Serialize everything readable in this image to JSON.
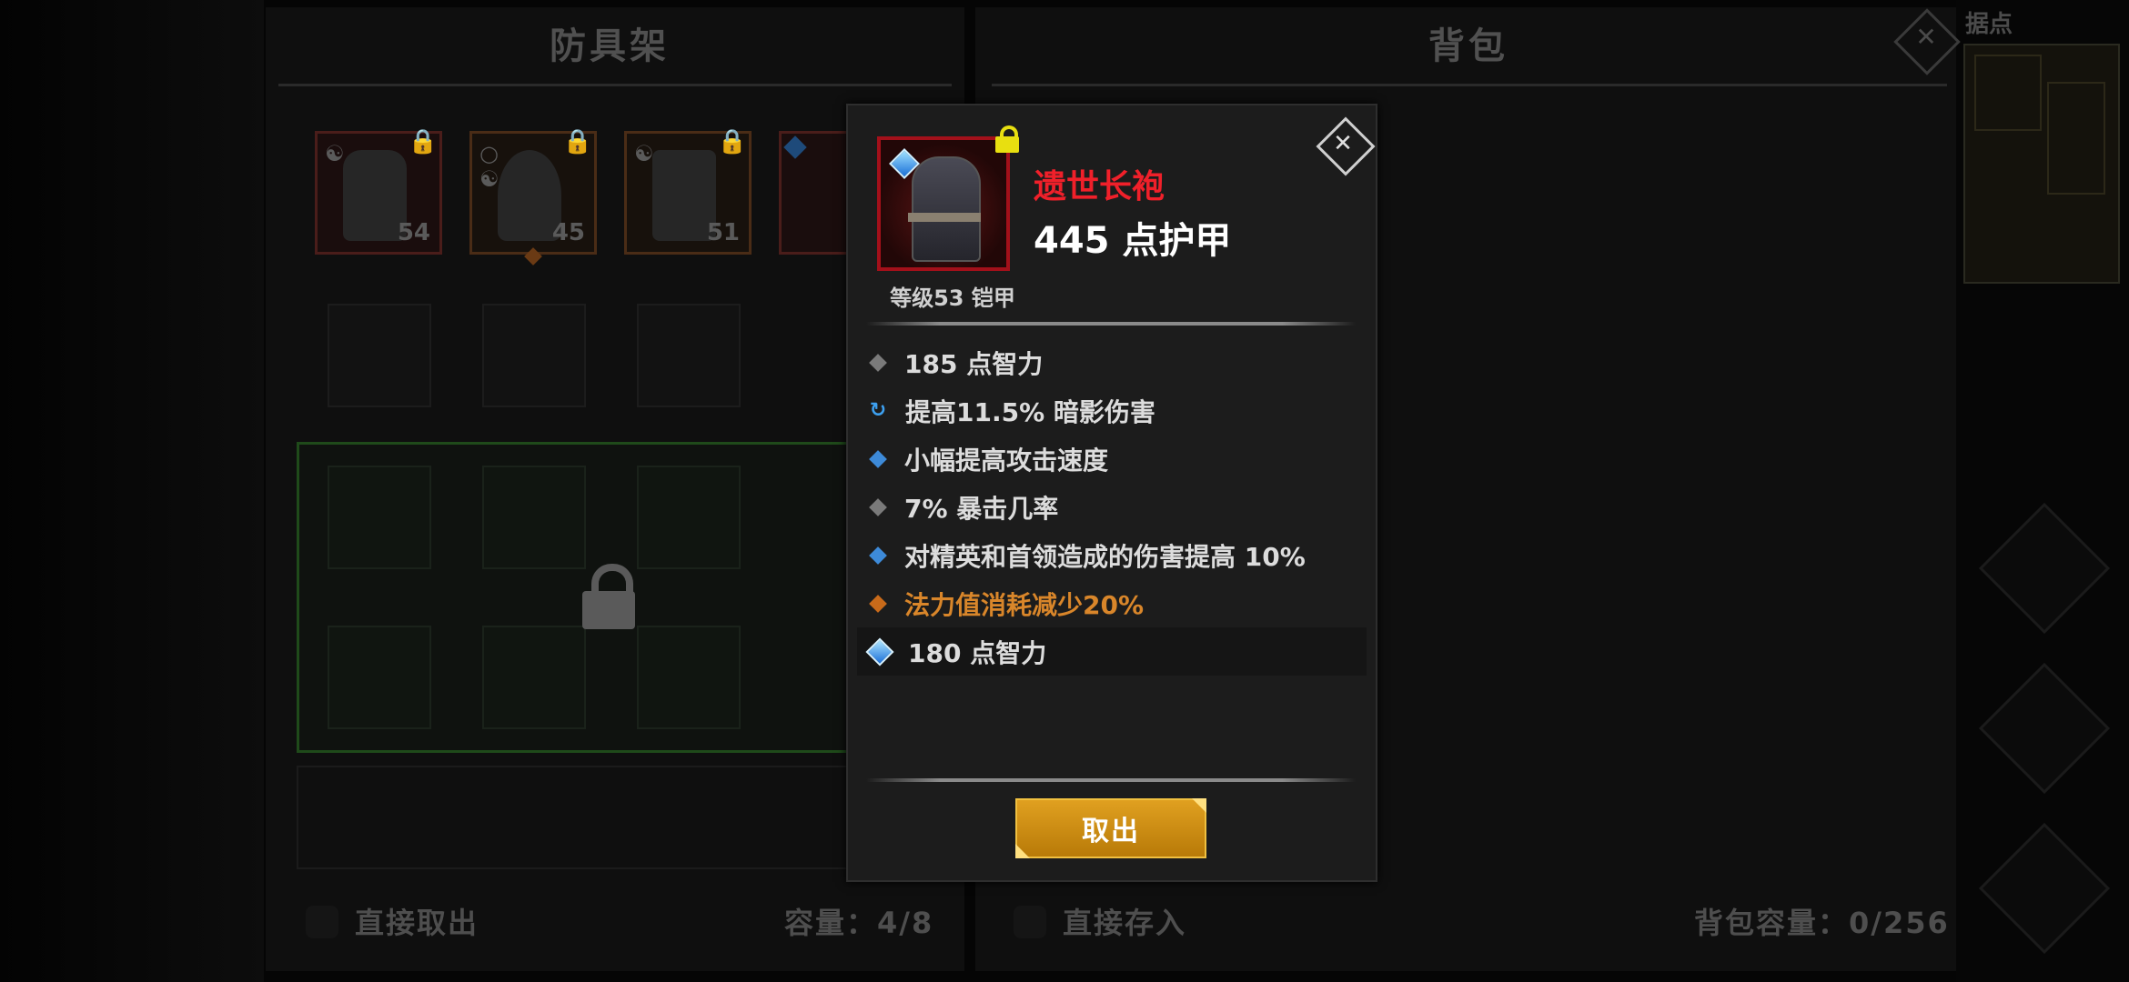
{
  "left_panel": {
    "title": "防具架",
    "slots": [
      {
        "level": "54",
        "icon": "helmet-icon"
      },
      {
        "level": "45",
        "icon": "hood-icon"
      },
      {
        "level": "51",
        "icon": "boots-icon"
      },
      {
        "level": "",
        "icon": "robe-icon"
      }
    ],
    "footer_checkbox_label": "直接取出",
    "capacity": "容量：4/8"
  },
  "right_panel": {
    "title": "背包",
    "footer_checkbox_label": "直接存入",
    "capacity": "背包容量：0/256"
  },
  "minimap": {
    "label": "据点"
  },
  "tooltip": {
    "item_name": "遗世长袍",
    "item_name_color": "#f0202a",
    "armor": "445 点护甲",
    "level_type": "等级53 铠甲",
    "stats": [
      {
        "text": "185 点智力",
        "marker": "gray"
      },
      {
        "text": "提高11.5% 暗影伤害",
        "marker": "cycle"
      },
      {
        "text": "小幅提高攻击速度",
        "marker": "blue"
      },
      {
        "text": "7% 暴击几率",
        "marker": "gray"
      },
      {
        "text": "对精英和首领造成的伤害提高 10%",
        "marker": "blue"
      },
      {
        "text": "法力值消耗减少20%",
        "marker": "orange"
      },
      {
        "text": "180 点智力",
        "marker": "gem"
      }
    ],
    "action_button": "取出"
  },
  "colors": {
    "accent_gold": "#e0a020",
    "legendary_orange": "#d9862a",
    "unique_red": "#f0202a"
  }
}
